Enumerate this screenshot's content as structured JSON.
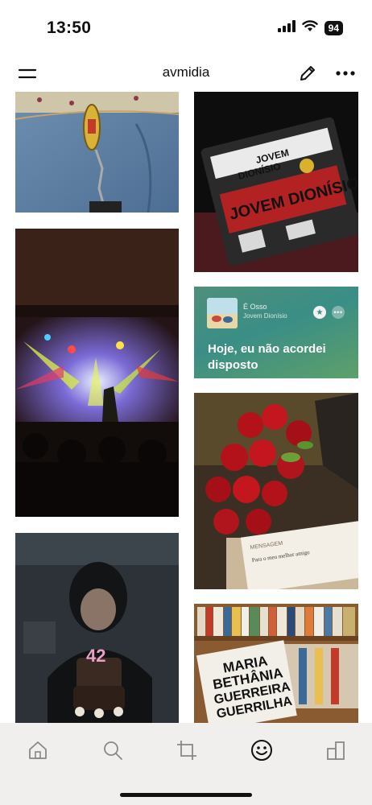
{
  "status_bar": {
    "time": "13:50",
    "battery": "94"
  },
  "header": {
    "title": "avmidia"
  },
  "music_card": {
    "track_title": "É Osso",
    "artist": "Jovem Dionísio",
    "lyric": "Hoje, eu não acordei disposto",
    "accent_color": "#3a8e86"
  },
  "photos": {
    "shirt_print_1": "JOVEM",
    "shirt_print_2": "DIONÍSIO",
    "shirt_print_3": "JOVEM DIONÍSIO",
    "card_text_1": "MENSAGEM",
    "card_text_2": "Para o meu melhor amigo",
    "book_title_1": "MARIA",
    "book_title_2": "BETHÂNIA",
    "book_title_3": "GUERREIRA",
    "book_title_4": "GUERRILHA",
    "cake_number": "42"
  },
  "tab_bar": {
    "active_tab": "profile",
    "icons": [
      "home-icon",
      "search-icon",
      "crop-icon",
      "smiley-icon",
      "building-icon"
    ]
  }
}
